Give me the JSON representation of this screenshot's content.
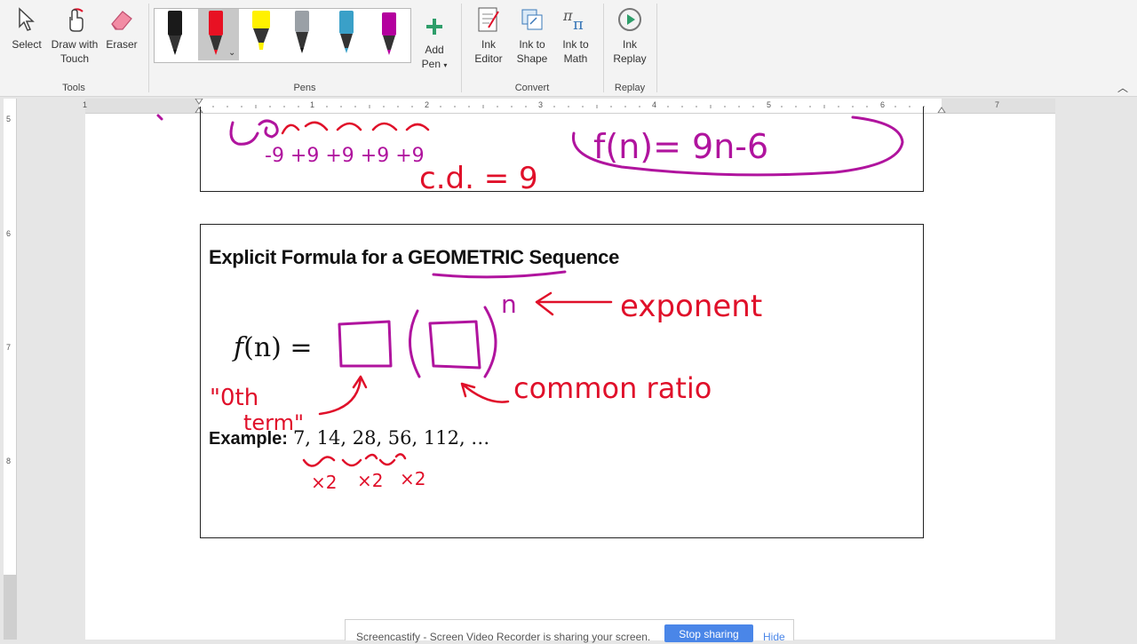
{
  "ribbon": {
    "tools": {
      "select": "Select",
      "draw_touch_1": "Draw with",
      "draw_touch_2": "Touch",
      "eraser": "Eraser",
      "group": "Tools"
    },
    "pens": {
      "add_pen_1": "Add",
      "add_pen_2": "Pen",
      "group": "Pens",
      "colors": [
        "#1a1a1a",
        "#e81123",
        "#fff100",
        "#9aa0a6",
        "#3aa0c8",
        "#b4009e"
      ]
    },
    "convert": {
      "ink_editor_1": "Ink",
      "ink_editor_2": "Editor",
      "ink_shape_1": "Ink to",
      "ink_shape_2": "Shape",
      "ink_math_1": "Ink to",
      "ink_math_2": "Math",
      "group": "Convert"
    },
    "replay": {
      "ink_replay_1": "Ink",
      "ink_replay_2": "Replay",
      "group": "Replay"
    }
  },
  "ruler": {
    "h_numbers": [
      "1",
      "1",
      "2",
      "3",
      "4",
      "5",
      "6",
      "7"
    ],
    "v_numbers": [
      "5",
      "6",
      "7",
      "8"
    ]
  },
  "document": {
    "heading_prefix": "Explicit Formula for a ",
    "heading_word": "GEOMETRIC",
    "heading_suffix": " Sequence",
    "formula_f": "f",
    "formula_rest": "(n) =",
    "example_label": "Example:",
    "example_sequence": "7, 14, 28, 56, 112, …"
  },
  "notification": {
    "text": "Screencastify - Screen Video Recorder is sharing your screen.",
    "stop": "Stop sharing",
    "hide": "Hide"
  },
  "colors": {
    "ink_red": "#e0102a",
    "ink_purple": "#b0149e",
    "accent_blue": "#4a86e8"
  }
}
